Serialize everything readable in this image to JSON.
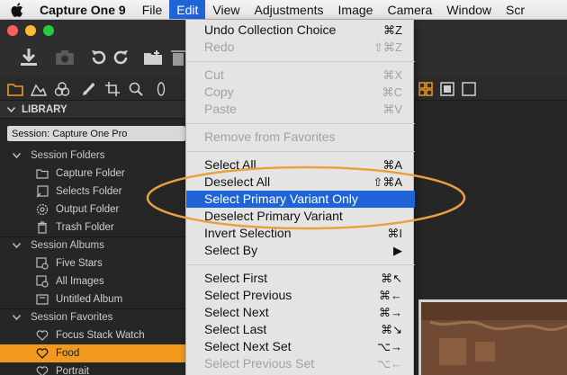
{
  "menubar": {
    "app_name": "Capture One 9",
    "items": [
      "File",
      "Edit",
      "View",
      "Adjustments",
      "Image",
      "Camera",
      "Window",
      "Scr"
    ]
  },
  "library": {
    "header": "LIBRARY",
    "session": "Session: Capture One Pro",
    "sections": {
      "folders": "Session Folders",
      "albums": "Session Albums",
      "favorites": "Session Favorites"
    },
    "items": {
      "capture_folder": "Capture Folder",
      "selects_folder": "Selects Folder",
      "output_folder": "Output Folder",
      "trash_folder": "Trash Folder",
      "five_stars": "Five Stars",
      "all_images": "All Images",
      "untitled_album": "Untitled Album",
      "focus_stack": "Focus Stack Watch",
      "food": "Food",
      "portrait": "Portrait"
    }
  },
  "edit_menu": {
    "undo": {
      "label": "Undo Collection Choice",
      "shortcut": "⌘Z"
    },
    "redo": {
      "label": "Redo",
      "shortcut": "⇧⌘Z"
    },
    "cut": {
      "label": "Cut",
      "shortcut": "⌘X"
    },
    "copy": {
      "label": "Copy",
      "shortcut": "⌘C"
    },
    "paste": {
      "label": "Paste",
      "shortcut": "⌘V"
    },
    "remove_fav": {
      "label": "Remove from Favorites"
    },
    "select_all": {
      "label": "Select All",
      "shortcut": "⌘A"
    },
    "deselect_all": {
      "label": "Deselect All",
      "shortcut": "⇧⌘A"
    },
    "select_primary": {
      "label": "Select Primary Variant Only"
    },
    "deselect_primary": {
      "label": "Deselect Primary Variant"
    },
    "invert": {
      "label": "Invert Selection",
      "shortcut": "⌘I"
    },
    "select_by": {
      "label": "Select By",
      "shortcut": "▶"
    },
    "select_first": {
      "label": "Select First",
      "shortcut": "⌘↖"
    },
    "select_prev": {
      "label": "Select Previous",
      "shortcut": "⌘←"
    },
    "select_next": {
      "label": "Select Next",
      "shortcut": "⌘→"
    },
    "select_last": {
      "label": "Select Last",
      "shortcut": "⌘↘"
    },
    "select_next_set": {
      "label": "Select Next Set",
      "shortcut": "⌥→"
    },
    "select_prev_set": {
      "label": "Select Previous Set",
      "shortcut": "⌥←"
    }
  },
  "colors": {
    "accent": "#f29a1d",
    "menu_highlight": "#1f63d8",
    "annotation": "#e8a040"
  }
}
